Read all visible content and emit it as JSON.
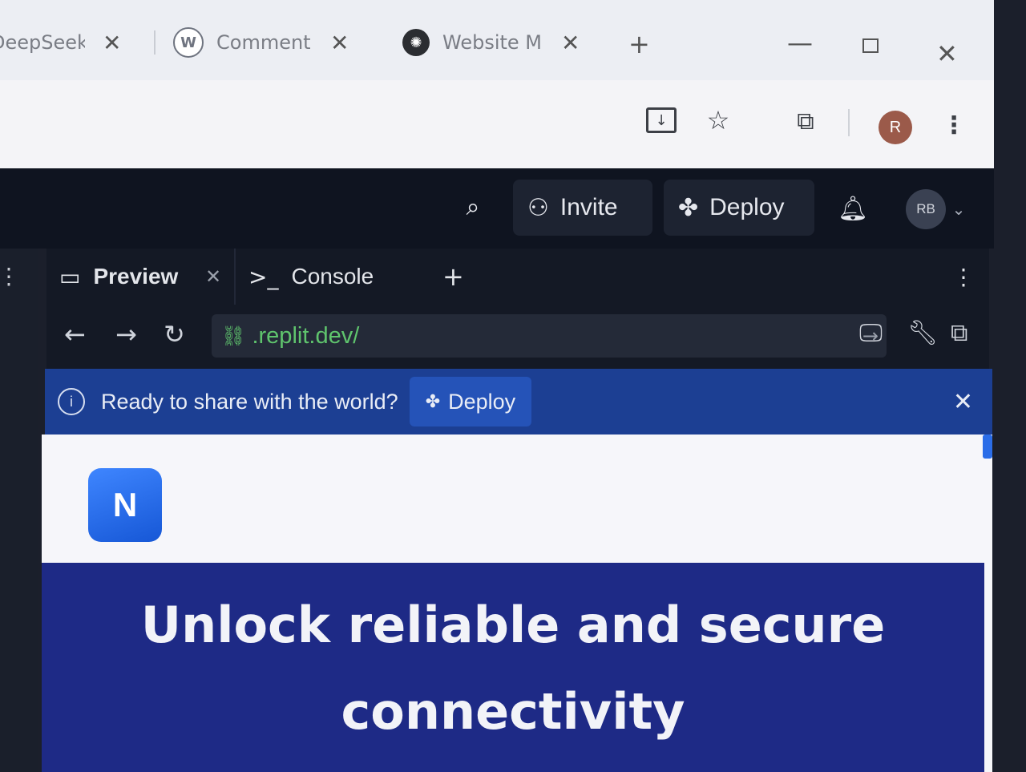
{
  "browser": {
    "tabs": [
      {
        "label": "DeepSeek",
        "favicon": "deepseek-icon"
      },
      {
        "label": "Comment",
        "favicon": "wordpress-icon"
      },
      {
        "label": "Website M",
        "favicon": "chatgpt-icon"
      }
    ],
    "profile_initial": "R"
  },
  "replit_header": {
    "invite_label": "Invite",
    "deploy_label": "Deploy",
    "avatar_initials": "RB"
  },
  "pane": {
    "tabs": [
      {
        "label": "Preview"
      },
      {
        "label": "Console"
      }
    ],
    "url": ".replit.dev/"
  },
  "banner": {
    "message": "Ready to share with the world?",
    "deploy_label": "Deploy",
    "color": "#1c3f93"
  },
  "site": {
    "logo_letter": "N",
    "headline": "Unlock reliable and secure connectivity",
    "hero_color": "#1e2a86"
  }
}
